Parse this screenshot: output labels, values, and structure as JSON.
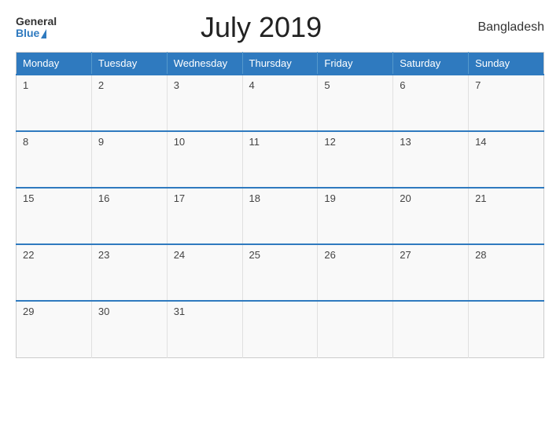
{
  "header": {
    "logo_general": "General",
    "logo_blue": "Blue",
    "month_title": "July 2019",
    "country": "Bangladesh"
  },
  "calendar": {
    "days_of_week": [
      "Monday",
      "Tuesday",
      "Wednesday",
      "Thursday",
      "Friday",
      "Saturday",
      "Sunday"
    ],
    "weeks": [
      [
        {
          "day": "1",
          "empty": false
        },
        {
          "day": "2",
          "empty": false
        },
        {
          "day": "3",
          "empty": false
        },
        {
          "day": "4",
          "empty": false
        },
        {
          "day": "5",
          "empty": false
        },
        {
          "day": "6",
          "empty": false
        },
        {
          "day": "7",
          "empty": false
        }
      ],
      [
        {
          "day": "8",
          "empty": false
        },
        {
          "day": "9",
          "empty": false
        },
        {
          "day": "10",
          "empty": false
        },
        {
          "day": "11",
          "empty": false
        },
        {
          "day": "12",
          "empty": false
        },
        {
          "day": "13",
          "empty": false
        },
        {
          "day": "14",
          "empty": false
        }
      ],
      [
        {
          "day": "15",
          "empty": false
        },
        {
          "day": "16",
          "empty": false
        },
        {
          "day": "17",
          "empty": false
        },
        {
          "day": "18",
          "empty": false
        },
        {
          "day": "19",
          "empty": false
        },
        {
          "day": "20",
          "empty": false
        },
        {
          "day": "21",
          "empty": false
        }
      ],
      [
        {
          "day": "22",
          "empty": false
        },
        {
          "day": "23",
          "empty": false
        },
        {
          "day": "24",
          "empty": false
        },
        {
          "day": "25",
          "empty": false
        },
        {
          "day": "26",
          "empty": false
        },
        {
          "day": "27",
          "empty": false
        },
        {
          "day": "28",
          "empty": false
        }
      ],
      [
        {
          "day": "29",
          "empty": false
        },
        {
          "day": "30",
          "empty": false
        },
        {
          "day": "31",
          "empty": false
        },
        {
          "day": "",
          "empty": true
        },
        {
          "day": "",
          "empty": true
        },
        {
          "day": "",
          "empty": true
        },
        {
          "day": "",
          "empty": true
        }
      ]
    ]
  }
}
